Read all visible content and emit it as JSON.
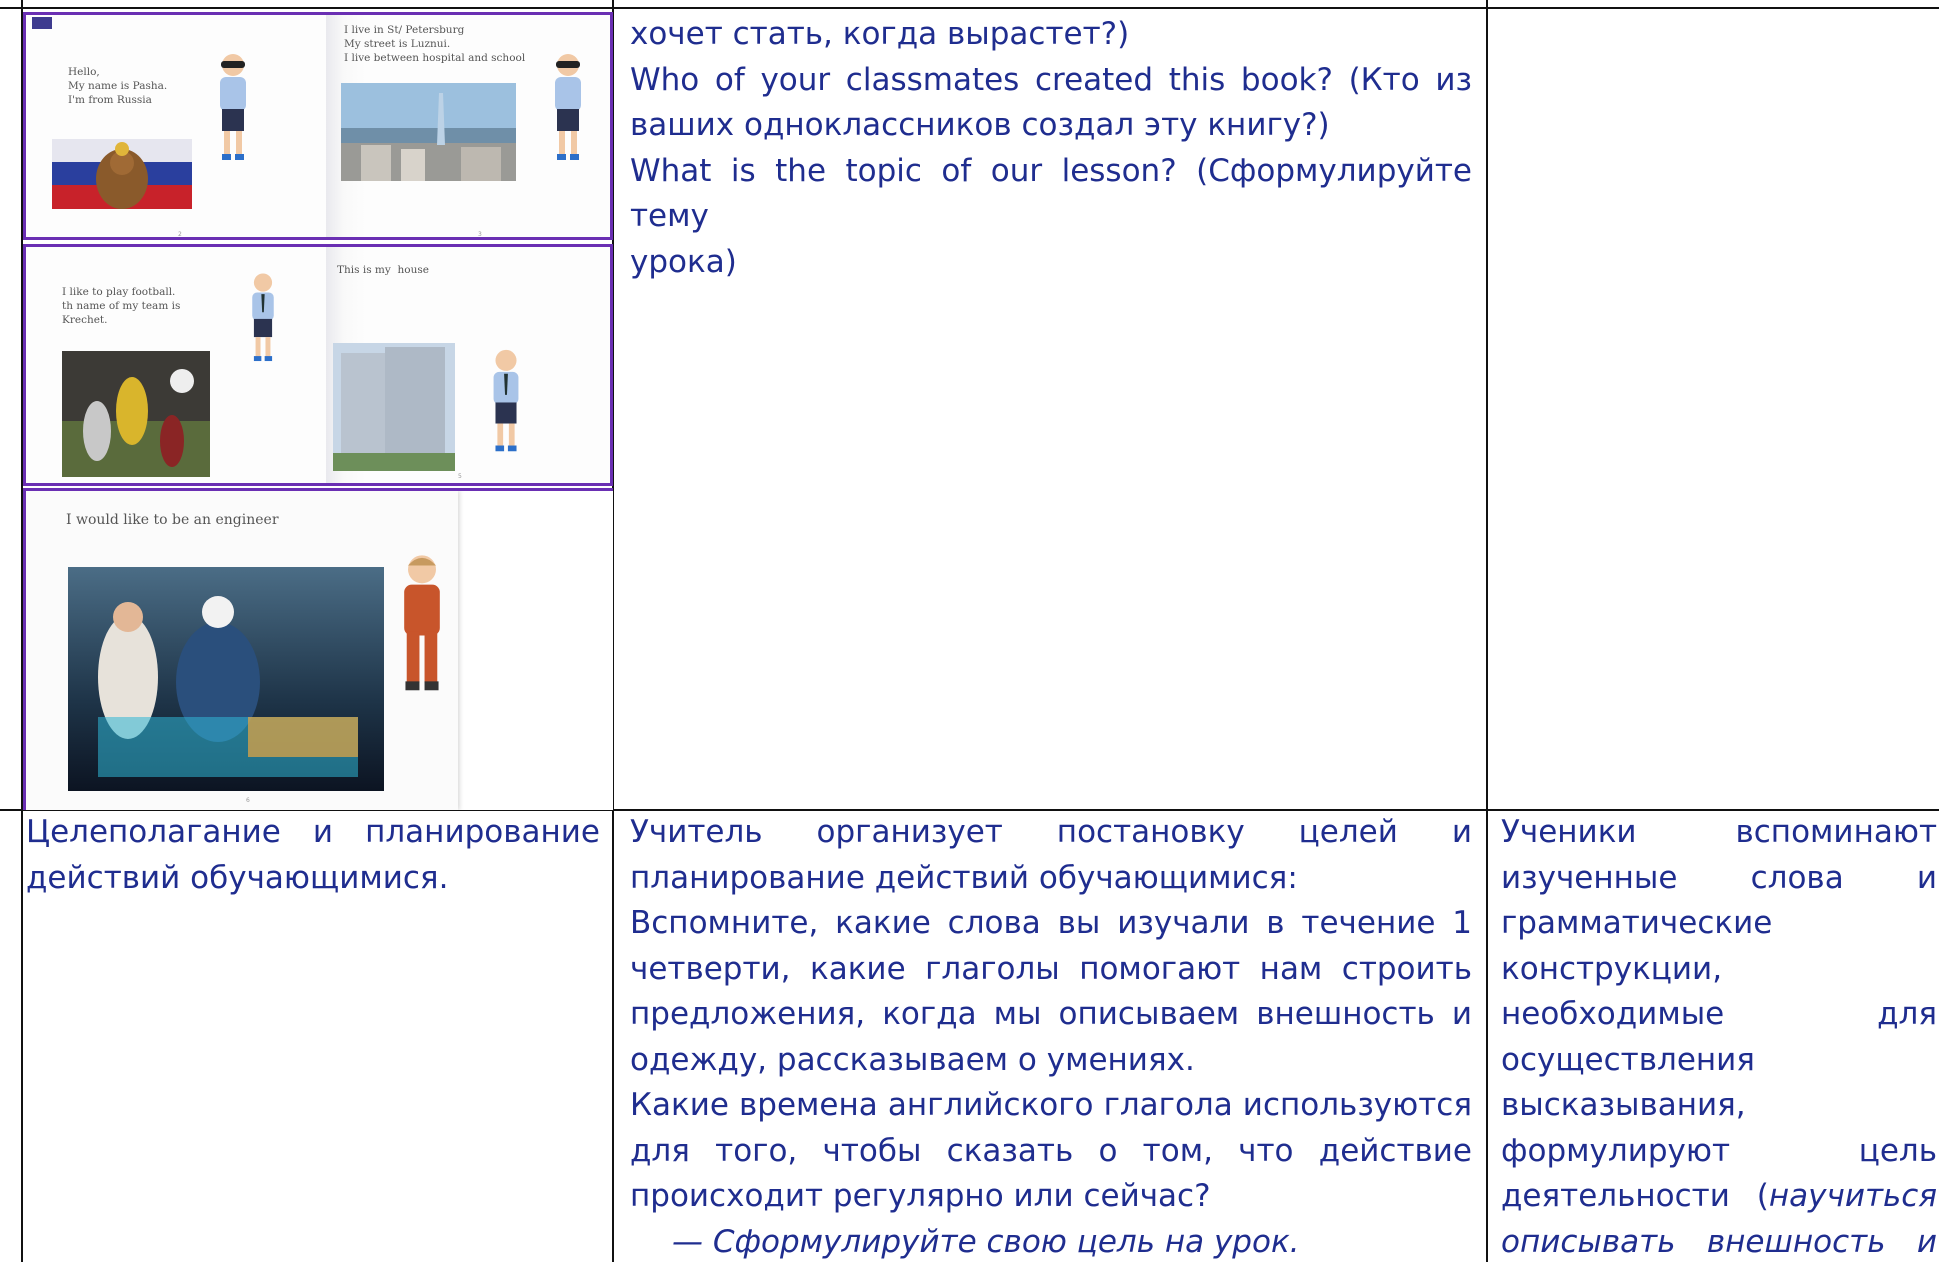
{
  "row1": {
    "col2_lines": [
      "хочет стать, когда вырастет?)",
      "Who of your classmates created this book? (Кто из",
      "ваших одноклассников создал эту книгу?)",
      "What is the topic of our lesson? (Сформулируйте тему",
      "урока)"
    ]
  },
  "book": {
    "spread1": {
      "left_text": "Hello,\nMy name is Pasha.\nI'm from Russia",
      "right_text": "I live in St/ Petersburg\nMy street is Luznui.\nI live between hospital and school",
      "page_left": "2",
      "page_right": "3"
    },
    "spread2": {
      "left_text": "I like to play football.\nth name of my team is\nKrechet.",
      "right_text": "This is my  house",
      "page_right": "5"
    },
    "spread3": {
      "left_text": "I would like to be an engineer",
      "page": "6"
    }
  },
  "row2": {
    "col1_lines": [
      "Целеполагание и планирование",
      "действий обучающимися."
    ],
    "col2_lines": [
      "Учитель организует постановку целей и",
      "планирование действий обучающимися:",
      "Вспомните, какие слова вы изучали в течение 1",
      "четверти, какие глаголы помогают нам строить",
      "предложения, когда мы описываем внешность и",
      "одежду, рассказываем о умениях.",
      "Какие времена английского глагола используются",
      "для того, чтобы сказать о том, что действие",
      "происходит регулярно или сейчас?"
    ],
    "col2_italic_prefix": "—",
    "col2_italic": "Сформулируйте свою цель на урок.",
    "col3_lines": [
      "Ученики вспоминают",
      "изученные слова и",
      "грамматические",
      "конструкции,",
      "необходимые для",
      "осуществления",
      "высказывания,",
      "формулируют цель"
    ],
    "col3_mixed_start": "деятельности (",
    "col3_mixed_italic": "научиться",
    "col3_italic_last": "описывать внешность и"
  },
  "colors": {
    "text": "#1f2d8f",
    "book_border": "#6a2fb3",
    "lines": "#111111"
  }
}
